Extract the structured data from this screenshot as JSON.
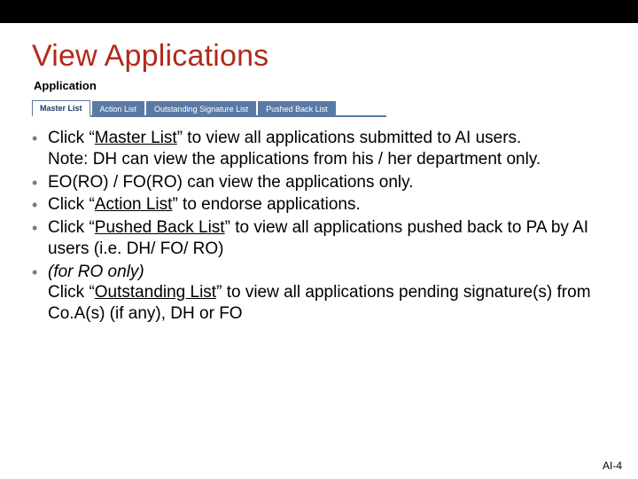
{
  "title": "View Applications",
  "app_header": "Application",
  "tabs": [
    {
      "label": "Master List",
      "active": true
    },
    {
      "label": "Action List",
      "active": false
    },
    {
      "label": "Outstanding Signature List",
      "active": false
    },
    {
      "label": "Pushed Back List",
      "active": false
    }
  ],
  "bullets": [
    {
      "pre": "Click “",
      "u": "Master List",
      "post": "” to view all applications submitted to AI users.\nNote: DH can view the applications from his / her department only."
    },
    {
      "pre": "EO(RO) / FO(RO) can view the applications only.",
      "u": "",
      "post": ""
    },
    {
      "pre": "Click “",
      "u": "Action List",
      "post": "” to endorse applications."
    },
    {
      "pre": "Click “",
      "u": "Pushed Back List",
      "post": "” to view all applications pushed back to PA by AI users (i.e. DH/ FO/ RO)"
    },
    {
      "em": "(for RO only)",
      "pre2": "\nClick “",
      "u": "Outstanding List",
      "post": "” to view all applications pending signature(s) from Co.A(s) (if any), DH or FO"
    }
  ],
  "footer": "AI-4"
}
